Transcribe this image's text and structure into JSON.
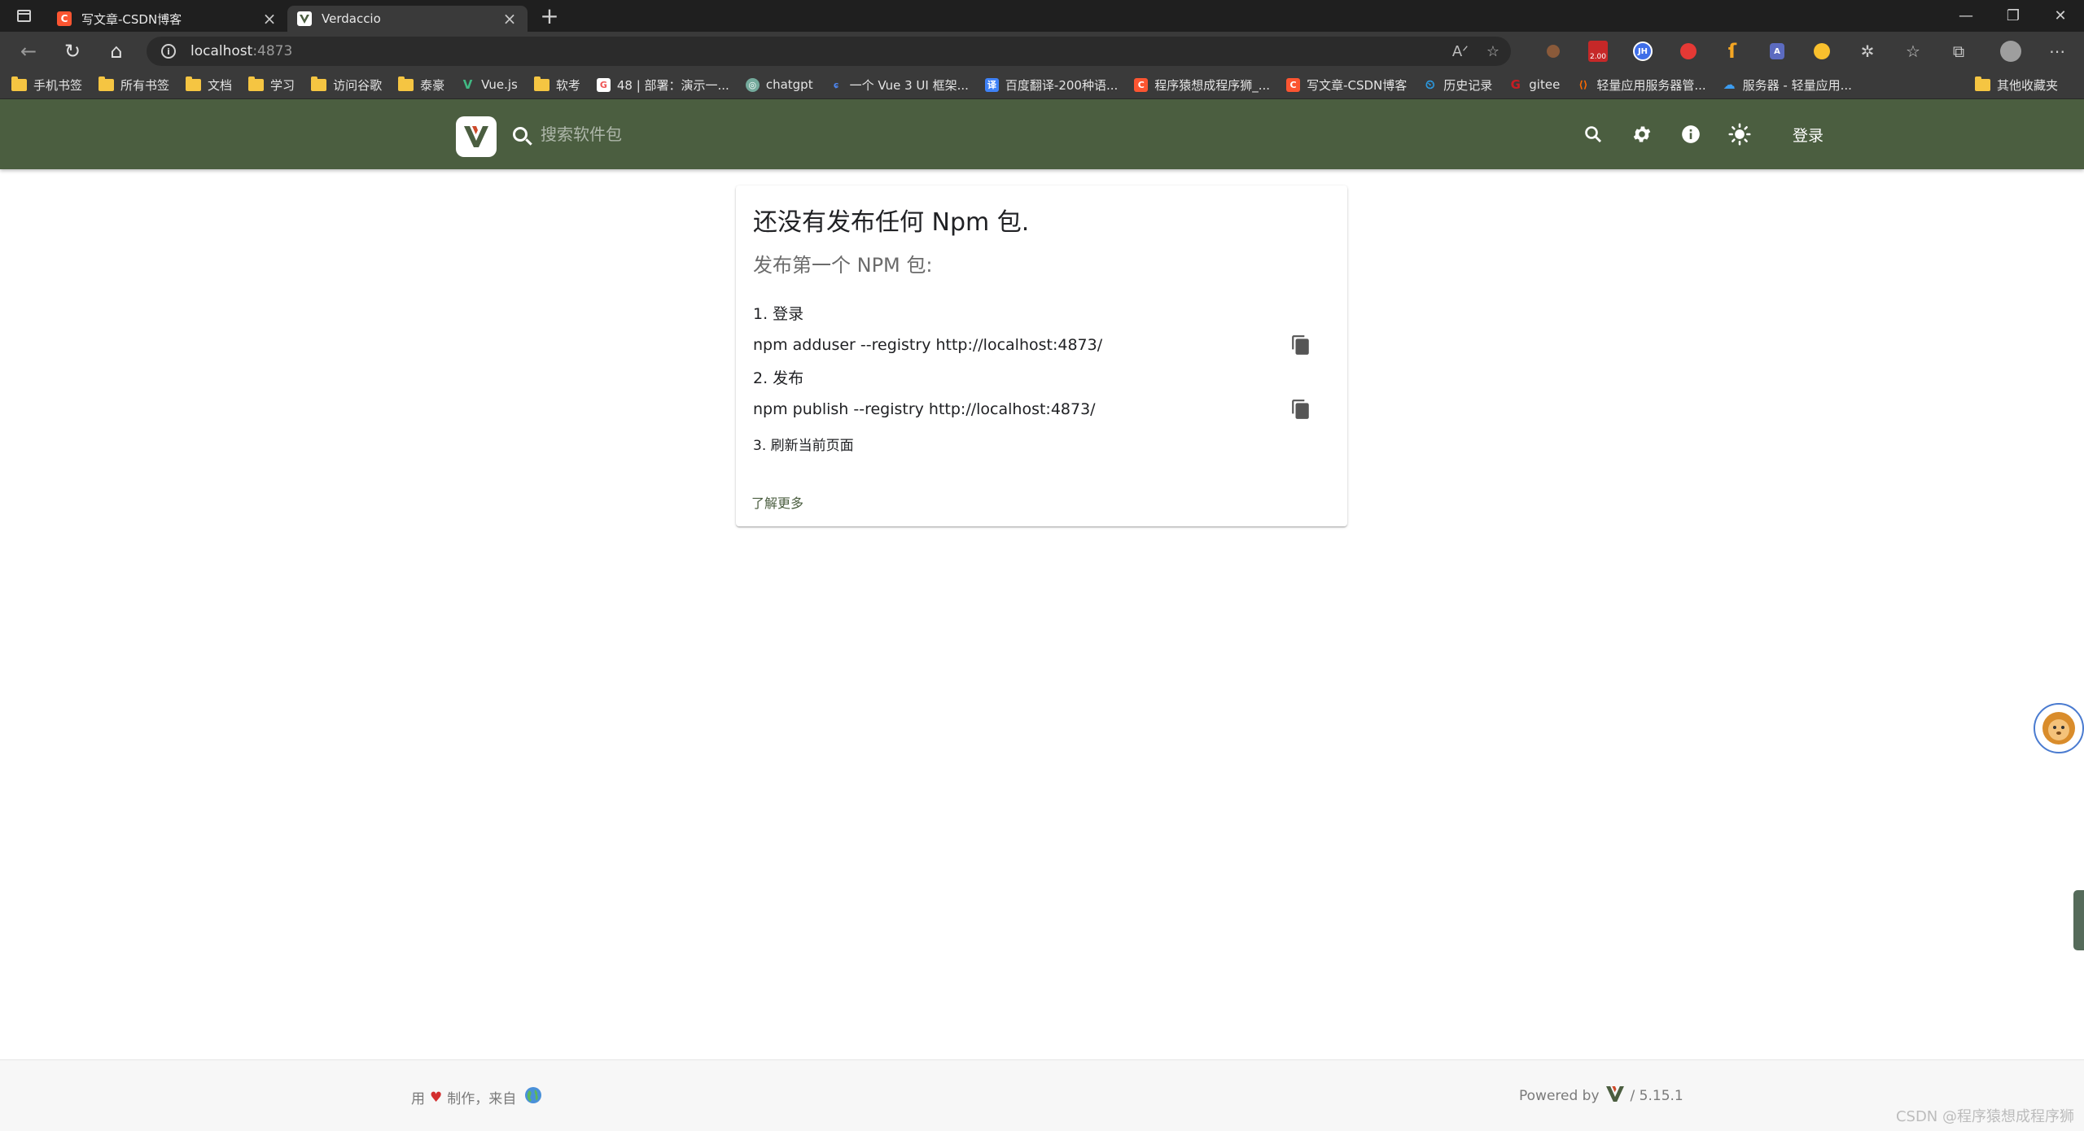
{
  "browser": {
    "tabs": [
      {
        "title": "写文章-CSDN博客",
        "favicon": "csdn-icon",
        "color": "#fc5531",
        "letter": "C"
      },
      {
        "title": "Verdaccio",
        "favicon": "verdaccio-icon",
        "color": "#ffffff",
        "letter": "V"
      }
    ],
    "url": {
      "host": "localhost",
      "port": ":4873"
    },
    "bookmarks": [
      {
        "label": "手机书签",
        "type": "folder"
      },
      {
        "label": "所有书签",
        "type": "folder"
      },
      {
        "label": "文档",
        "type": "folder"
      },
      {
        "label": "学习",
        "type": "folder"
      },
      {
        "label": "访问谷歌",
        "type": "folder"
      },
      {
        "label": "泰豪",
        "type": "folder"
      },
      {
        "label": "Vue.js",
        "type": "link",
        "color": "#41b883",
        "letter": "V"
      },
      {
        "label": "软考",
        "type": "folder"
      },
      {
        "label": "48 | 部署：演示一...",
        "type": "link",
        "color": "#ffffff",
        "letter": "G"
      },
      {
        "label": "chatgpt",
        "type": "link",
        "color": "#74aa9c",
        "letter": "◎"
      },
      {
        "label": "一个 Vue 3 UI 框架...",
        "type": "link",
        "color": "#2f6fde",
        "letter": "ɕ"
      },
      {
        "label": "百度翻译-200种语...",
        "type": "link",
        "color": "#3f82f7",
        "letter": "译"
      },
      {
        "label": "程序猿想成程序狮_...",
        "type": "link",
        "color": "#fc5531",
        "letter": "C"
      },
      {
        "label": "写文章-CSDN博客",
        "type": "link",
        "color": "#fc5531",
        "letter": "C"
      },
      {
        "label": "历史记录",
        "type": "link",
        "color": "#2b9ee8",
        "letter": "⏲"
      },
      {
        "label": "gitee",
        "type": "link",
        "color": "#c71d23",
        "letter": "G"
      },
      {
        "label": "轻量应用服务器管...",
        "type": "link",
        "color": "#ff6a00",
        "letter": "⟨⟩"
      },
      {
        "label": "服务器 - 轻量应用...",
        "type": "link",
        "color": "#3c9cf0",
        "letter": "☁"
      }
    ],
    "other_bookmarks": "其他收藏夹",
    "extension_badge": "2.00"
  },
  "app": {
    "search_placeholder": "搜索软件包",
    "login_label": "登录",
    "brand_color": "#4b5e40"
  },
  "empty_state": {
    "title": "还没有发布任何 Npm 包.",
    "subtitle": "发布第一个 NPM 包:",
    "step1_label": "1. 登录",
    "step1_cmd": "npm adduser --registry http://localhost:4873/",
    "step2_label": "2. 发布",
    "step2_cmd": "npm publish --registry http://localhost:4873/",
    "step3_label": "3. 刷新当前页面",
    "learn_more": "了解更多"
  },
  "footer": {
    "made_with": "用",
    "made_by": "制作，来自",
    "powered_by": "Powered by",
    "version": "/ 5.15.1"
  },
  "watermark": "CSDN @程序猿想成程序狮"
}
